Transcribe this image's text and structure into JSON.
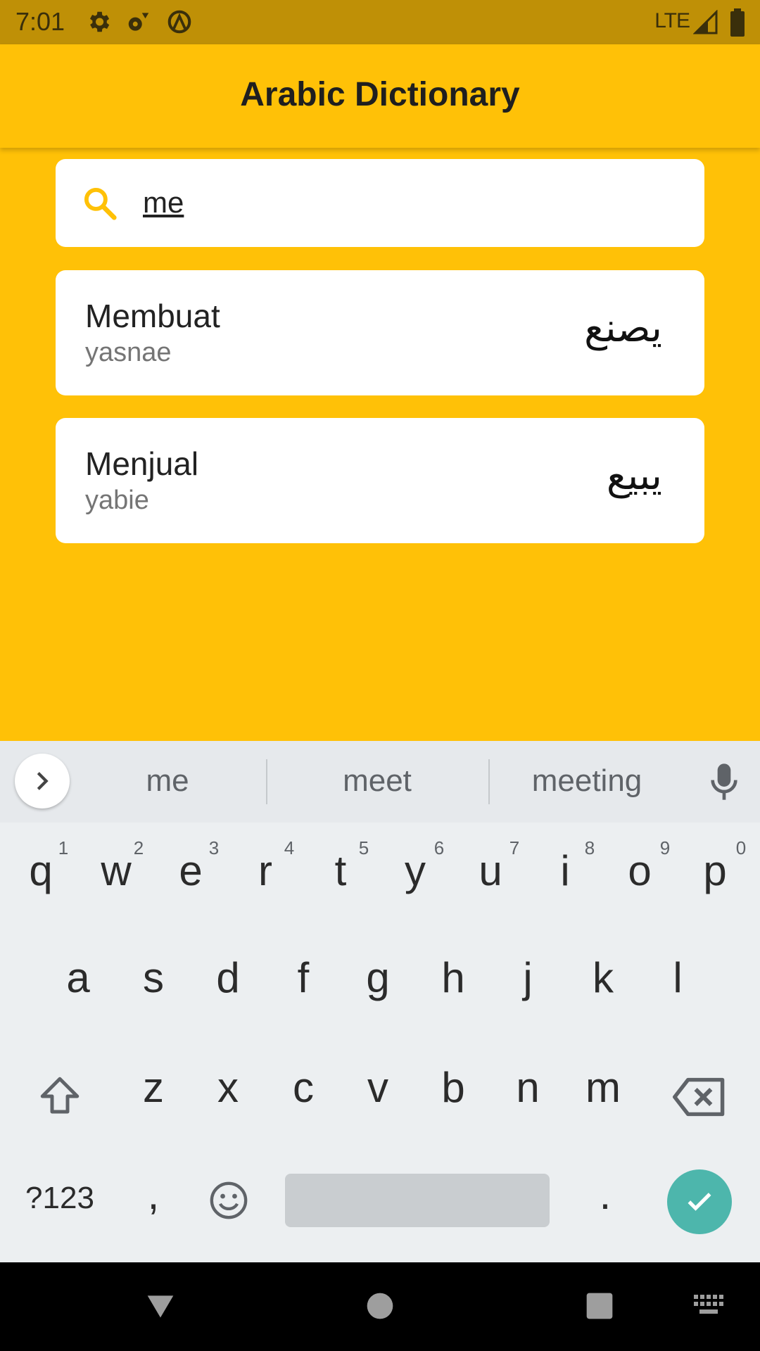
{
  "status_bar": {
    "time": "7:01",
    "network": "LTE",
    "icons": [
      "settings-icon",
      "settings-gear-icon",
      "data-saver-icon",
      "signal-icon",
      "battery-icon"
    ]
  },
  "app_bar": {
    "title": "Arabic Dictionary"
  },
  "search": {
    "value": "me",
    "placeholder": ""
  },
  "results": [
    {
      "word": "Membuat",
      "transliteration": "yasnae",
      "arabic": "يصنع"
    },
    {
      "word": "Menjual",
      "transliteration": "yabie",
      "arabic": "يبيع"
    }
  ],
  "keyboard": {
    "suggestions": [
      "me",
      "meet",
      "meeting"
    ],
    "row1": [
      "q",
      "w",
      "e",
      "r",
      "t",
      "y",
      "u",
      "i",
      "o",
      "p"
    ],
    "row1_hints": [
      "1",
      "2",
      "3",
      "4",
      "5",
      "6",
      "7",
      "8",
      "9",
      "0"
    ],
    "row2": [
      "a",
      "s",
      "d",
      "f",
      "g",
      "h",
      "j",
      "k",
      "l"
    ],
    "row3": [
      "z",
      "x",
      "c",
      "v",
      "b",
      "n",
      "m"
    ],
    "symbols_label": "?123",
    "comma": ",",
    "period": "."
  },
  "colors": {
    "primary": "#FFC107",
    "status_bar": "#BF9006",
    "enter_key": "#4DB6AC"
  }
}
